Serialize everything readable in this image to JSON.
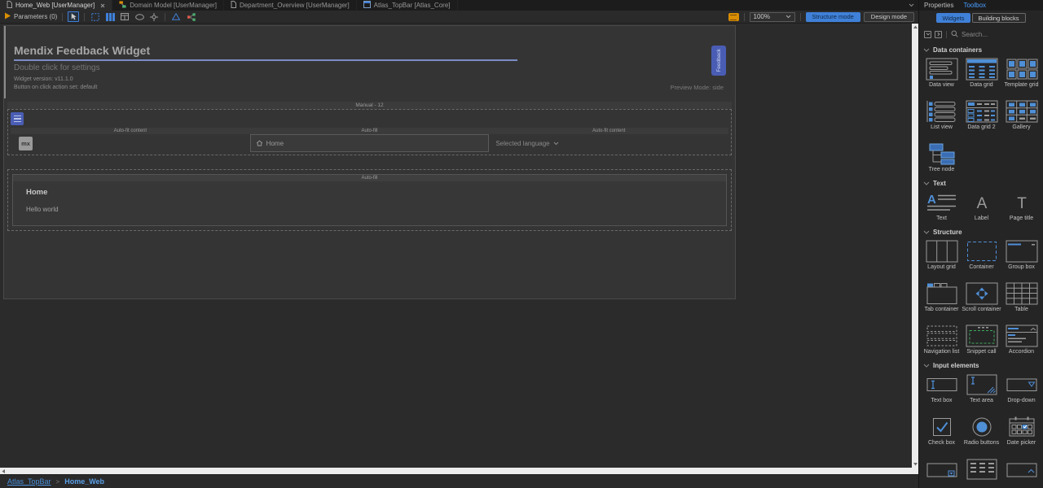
{
  "tab_bar": {
    "tabs": [
      {
        "label": "Home_Web [UserManager]",
        "icon": "page-icon",
        "active": true,
        "closable": true
      },
      {
        "label": "Domain Model [UserManager]",
        "icon": "domain-model-icon",
        "active": false,
        "closable": false
      },
      {
        "label": "Department_Overview [UserManager]",
        "icon": "page-icon",
        "active": false,
        "closable": false
      },
      {
        "label": "Atlas_TopBar [Atlas_Core]",
        "icon": "layout-icon",
        "active": false,
        "closable": false
      }
    ]
  },
  "toolbar": {
    "parameters_label": "Parameters (0)",
    "zoom_value": "100%",
    "structure_mode_label": "Structure mode",
    "design_mode_label": "Design mode"
  },
  "page_editor": {
    "widget_header": {
      "title": "Mendix Feedback Widget",
      "subtitle": "Double click for settings",
      "version_line": "Widget version: v11.1.0",
      "action_line": "Button on click action set: default",
      "feedback_button_label": "Feedback",
      "preview_mode_label": "Preview Mode: side"
    },
    "layout_row_label": "Manual - 12",
    "nav_row": {
      "columns": [
        {
          "header": "Auto-fit content"
        },
        {
          "header": "Auto-fill"
        },
        {
          "header": "Auto-fit content"
        }
      ],
      "brand_logo_text": "mx",
      "menu_item_label": "Home",
      "language_selector_label": "Selected language"
    },
    "content_region": {
      "header": "Auto-fill",
      "title": "Home",
      "body_text": "Hello world"
    }
  },
  "breadcrumb": {
    "items": [
      {
        "label": "Atlas_TopBar"
      },
      {
        "label": "Home_Web"
      }
    ],
    "separator": ">"
  },
  "sidebar": {
    "panel_tabs": [
      {
        "label": "Properties",
        "active": false
      },
      {
        "label": "Toolbox",
        "active": true
      }
    ],
    "view_buttons": [
      {
        "label": "Widgets",
        "active": true
      },
      {
        "label": "Building blocks",
        "active": false
      }
    ],
    "search_placeholder": "Search...",
    "categories": [
      {
        "name": "Data containers",
        "items": [
          {
            "label": "Data view",
            "icon": "data-view"
          },
          {
            "label": "Data grid",
            "icon": "data-grid"
          },
          {
            "label": "Template grid",
            "icon": "template-grid"
          },
          {
            "label": "List view",
            "icon": "list-view"
          },
          {
            "label": "Data grid 2",
            "icon": "data-grid-2"
          },
          {
            "label": "Gallery",
            "icon": "gallery"
          },
          {
            "label": "Tree node",
            "icon": "tree-node"
          }
        ]
      },
      {
        "name": "Text",
        "items": [
          {
            "label": "Text",
            "icon": "text"
          },
          {
            "label": "Label",
            "icon": "label"
          },
          {
            "label": "Page title",
            "icon": "page-title"
          }
        ]
      },
      {
        "name": "Structure",
        "items": [
          {
            "label": "Layout grid",
            "icon": "layout-grid"
          },
          {
            "label": "Container",
            "icon": "container"
          },
          {
            "label": "Group box",
            "icon": "group-box"
          },
          {
            "label": "Tab container",
            "icon": "tab-container"
          },
          {
            "label": "Scroll container",
            "icon": "scroll-container"
          },
          {
            "label": "Table",
            "icon": "table"
          },
          {
            "label": "Navigation list",
            "icon": "navigation-list"
          },
          {
            "label": "Snippet call",
            "icon": "snippet-call"
          },
          {
            "label": "Accordion",
            "icon": "accordion"
          }
        ]
      },
      {
        "name": "Input elements",
        "items": [
          {
            "label": "Text box",
            "icon": "text-box"
          },
          {
            "label": "Text area",
            "icon": "text-area"
          },
          {
            "label": "Drop-down",
            "icon": "drop-down"
          },
          {
            "label": "Check box",
            "icon": "check-box"
          },
          {
            "label": "Radio buttons",
            "icon": "radio-buttons"
          },
          {
            "label": "Date picker",
            "icon": "date-picker"
          },
          {
            "label": "",
            "icon": "reference-selector"
          },
          {
            "label": "",
            "icon": "reference-set-selector"
          },
          {
            "label": "",
            "icon": "combo-box"
          }
        ]
      }
    ]
  },
  "colors": {
    "accent_blue": "#3f80d8",
    "widget_blue": "#4a5db4",
    "icon_blue": "#4f8fd6",
    "orange": "#d98e04",
    "link_blue": "#4a90d9",
    "snippet_green": "#3faa5c"
  }
}
